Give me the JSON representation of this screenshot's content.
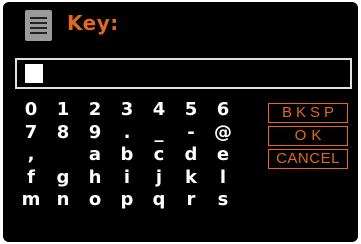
{
  "header": {
    "icon": "keyboard-icon",
    "title": "Key:"
  },
  "input": {
    "value": ""
  },
  "keys": [
    [
      "0",
      "1",
      "2",
      "3",
      "4",
      "5",
      "6"
    ],
    [
      "7",
      "8",
      "9",
      ".",
      "_",
      "-",
      "@"
    ],
    [
      ",",
      "",
      "a",
      "b",
      "c",
      "d",
      "e"
    ],
    [
      "f",
      "g",
      "h",
      "i",
      "j",
      "k",
      "l"
    ],
    [
      "m",
      "n",
      "o",
      "p",
      "q",
      "r",
      "s"
    ]
  ],
  "buttons": {
    "backspace": "BKSP",
    "ok": "OK",
    "cancel": "CANCEL"
  },
  "colors": {
    "accent": "#e0691f",
    "background": "#000000",
    "text": "#ffffff"
  }
}
